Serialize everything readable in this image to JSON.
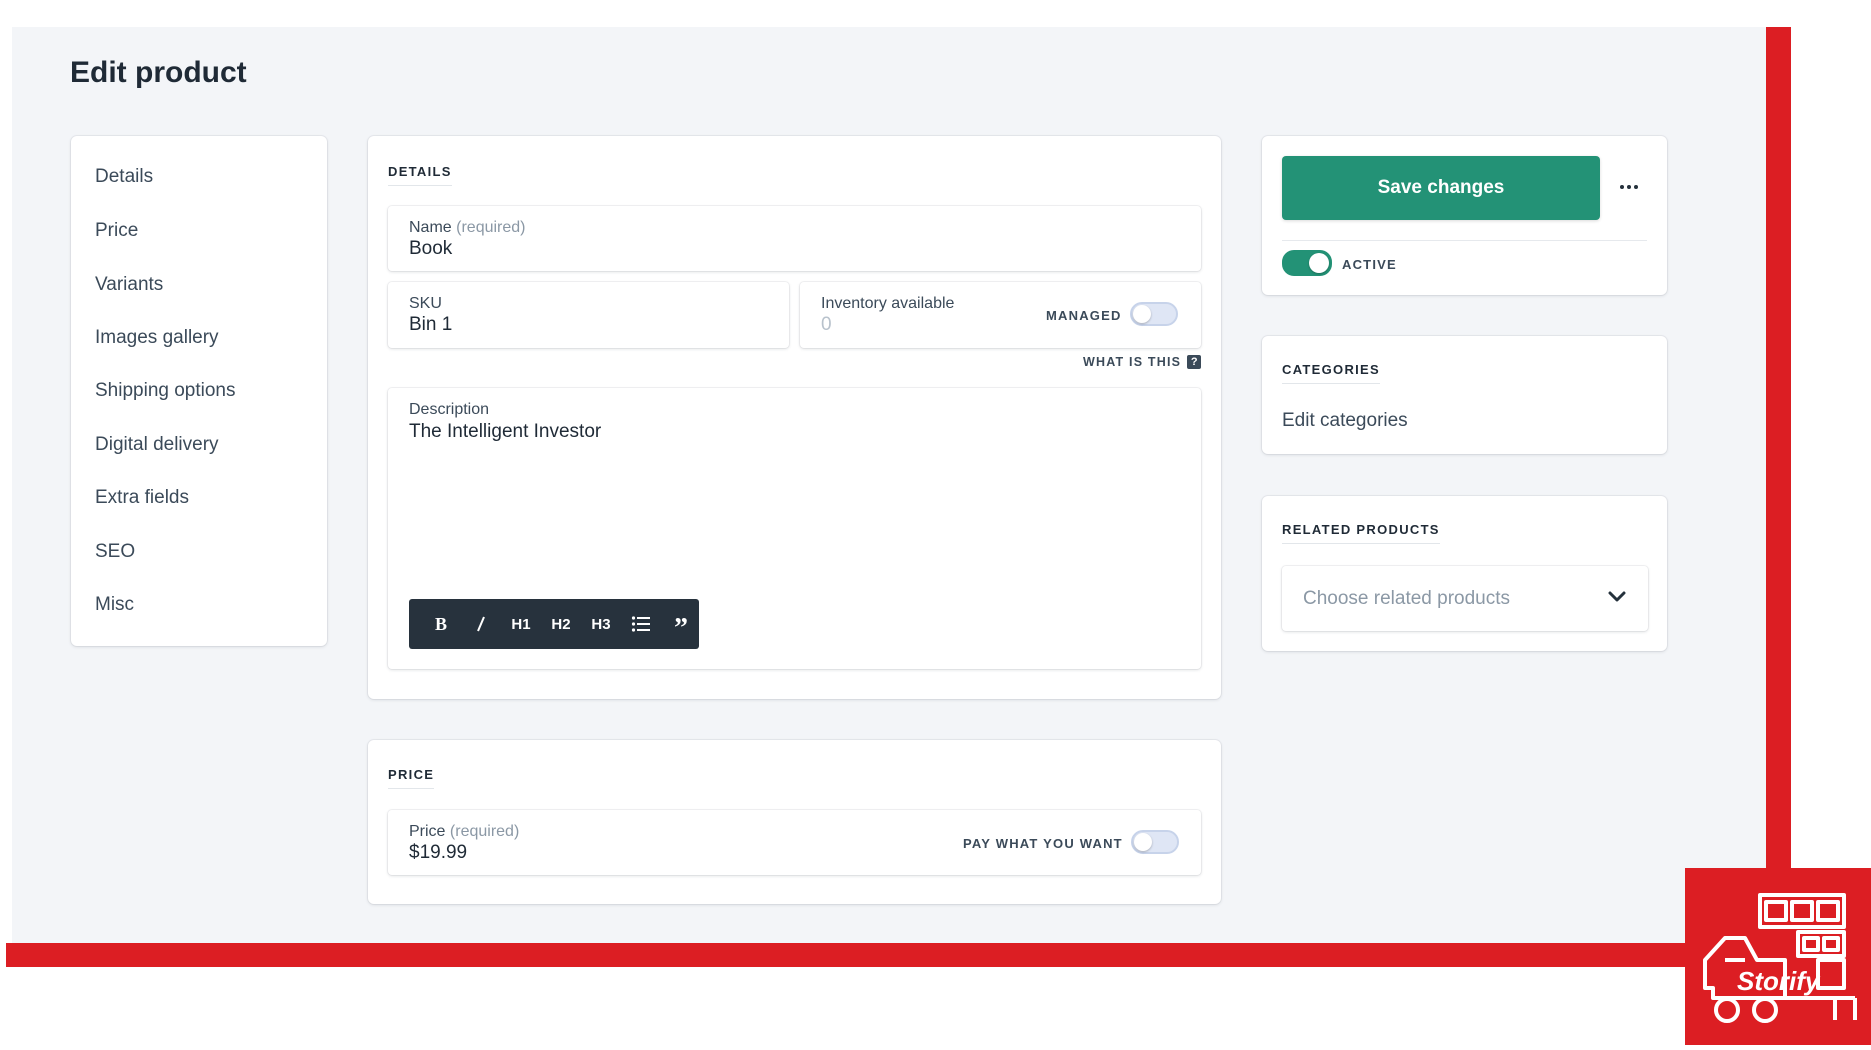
{
  "page": {
    "title": "Edit product"
  },
  "sidebar": {
    "items": [
      {
        "label": "Details"
      },
      {
        "label": "Price"
      },
      {
        "label": "Variants"
      },
      {
        "label": "Images gallery"
      },
      {
        "label": "Shipping options"
      },
      {
        "label": "Digital delivery"
      },
      {
        "label": "Extra fields"
      },
      {
        "label": "SEO"
      },
      {
        "label": "Misc"
      }
    ]
  },
  "details": {
    "section_title": "DETAILS",
    "name": {
      "label": "Name",
      "required": "(required)",
      "value": "Book"
    },
    "sku": {
      "label": "SKU",
      "value": "Bin 1"
    },
    "inventory": {
      "label": "Inventory available",
      "placeholder": "0",
      "managed_label": "MANAGED",
      "managed_on": false
    },
    "what_is_this": "WHAT IS THIS",
    "what_is_this_icon": "?",
    "description": {
      "label": "Description",
      "value": "The Intelligent Investor"
    },
    "toolbar": {
      "bold": "B",
      "h1": "H1",
      "h2": "H2",
      "h3": "H3",
      "quote": "”"
    }
  },
  "price": {
    "section_title": "PRICE",
    "price": {
      "label": "Price",
      "required": "(required)",
      "value": "$19.99"
    },
    "pay_what_you_want_label": "PAY WHAT YOU WANT",
    "pay_what_you_want_on": false
  },
  "actions": {
    "save_label": "Save changes",
    "active_label": "ACTIVE",
    "active_on": true
  },
  "categories": {
    "section_title": "CATEGORIES",
    "edit_link": "Edit categories"
  },
  "related_products": {
    "section_title": "RELATED PRODUCTS",
    "placeholder": "Choose related products"
  },
  "branding": {
    "logo_text": "Storify",
    "accent_color": "#dc1e23",
    "primary_color": "#239276"
  }
}
